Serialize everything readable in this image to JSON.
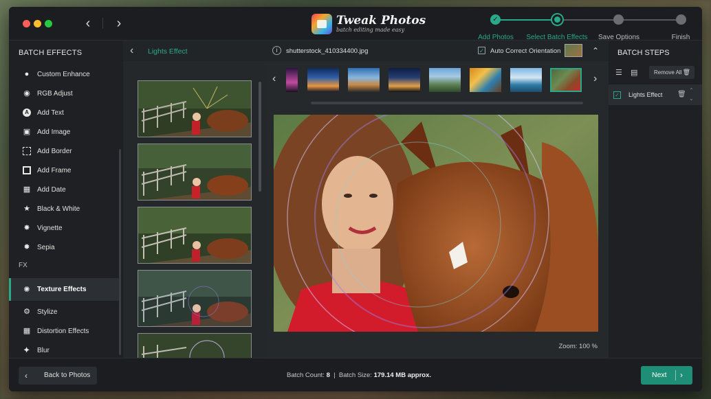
{
  "app": {
    "logo_title": "Tweak Photos",
    "logo_subtitle": "batch editing made easy"
  },
  "steps": [
    {
      "label": "Add Photos",
      "state": "done"
    },
    {
      "label": "Select Batch Effects",
      "state": "current"
    },
    {
      "label": "Save Options",
      "state": "pending"
    },
    {
      "label": "Finish",
      "state": "pending"
    }
  ],
  "colors": {
    "accent": "#2aa98a",
    "next_button": "#1e8f76"
  },
  "left_panel": {
    "title": "BATCH EFFECTS",
    "items": [
      {
        "label": "Custom Enhance",
        "icon": "bulb-icon"
      },
      {
        "label": "RGB Adjust",
        "icon": "rgb-icon"
      },
      {
        "label": "Add Text",
        "icon": "text-icon"
      },
      {
        "label": "Add Image",
        "icon": "image-icon"
      },
      {
        "label": "Add Border",
        "icon": "border-icon"
      },
      {
        "label": "Add Frame",
        "icon": "frame-icon"
      },
      {
        "label": "Add Date",
        "icon": "calendar-icon"
      },
      {
        "label": "Black & White",
        "icon": "star-icon"
      },
      {
        "label": "Vignette",
        "icon": "vignette-icon"
      },
      {
        "label": "Sepia",
        "icon": "sepia-icon"
      }
    ],
    "fx_label": "FX",
    "fx_items": [
      {
        "label": "Texture Effects",
        "icon": "texture-icon",
        "active": true
      },
      {
        "label": "Stylize",
        "icon": "stylize-icon"
      },
      {
        "label": "Distortion Effects",
        "icon": "grid-icon"
      },
      {
        "label": "Blur",
        "icon": "drop-icon"
      }
    ]
  },
  "thumb_column": {
    "title": "Lights Effect"
  },
  "center": {
    "file_name": "shutterstock_410334400.jpg",
    "auto_correct_label": "Auto Correct Orientation",
    "zoom_label": "Zoom: 100 %"
  },
  "right_panel": {
    "title": "BATCH STEPS",
    "remove_all_label": "Remove  All",
    "step_item": "Lights Effect"
  },
  "bottom": {
    "back_label": "Back to Photos",
    "batch_count_label": "Batch Count:",
    "batch_count_value": "8",
    "batch_size_label": "Batch Size:",
    "batch_size_value": "179.14 MB approx.",
    "next_label": "Next"
  }
}
